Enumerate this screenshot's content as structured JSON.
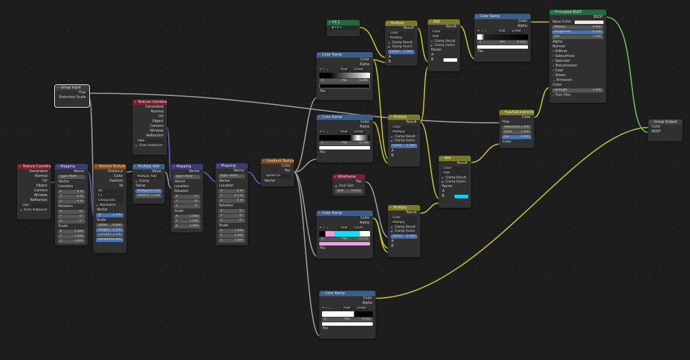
{
  "nodes": {
    "tex_coord_1": {
      "title": "Texture Coordinate",
      "outputs": [
        "Generated",
        "Normal",
        "UV",
        "Object",
        "Camera",
        "Window",
        "Reflection"
      ],
      "object_label": "Obje...",
      "from_instancer": "From Instancer"
    },
    "mapping_1": {
      "title": "Mapping",
      "out": "Vector",
      "type_label": "Type:",
      "type_value": "Point",
      "inputs": {
        "vector": "Vector",
        "location": "Location",
        "rotation": "Rotation",
        "scale": "Scale"
      },
      "location": [
        [
          "X",
          "0 m"
        ],
        [
          "Y",
          "0 m"
        ],
        [
          "Z",
          "0 m"
        ]
      ],
      "rotation": [
        [
          "X",
          "0°"
        ],
        [
          "Y",
          "0°"
        ],
        [
          "Z",
          "0°"
        ]
      ],
      "scale": [
        [
          "X",
          "1.000"
        ],
        [
          "Y",
          "1.000"
        ],
        [
          "Z",
          "1.000"
        ]
      ]
    },
    "voronoi": {
      "title": "Voronoi Texture",
      "outputs": [
        "Distance",
        "Color",
        "Position",
        "W"
      ],
      "dims": "4D",
      "feature": "F1",
      "metric": "Chebychev",
      "normalize": "Normalize",
      "vector": "Vector",
      "w_label": "W",
      "w_value": "1.200",
      "scale_label": "Scale",
      "detail_label": "Detail",
      "detail_value": "0.000",
      "rough_label": "Roughn...",
      "rough_value": "0.500",
      "lac_label": "Lacunari...",
      "lac_value": "2.000",
      "rand_label": "Randomn...",
      "rand_value": "1.000"
    },
    "mul_add": {
      "title": "Multiply Add",
      "out": "Value",
      "op": "Multiply Add",
      "clamp": "Clamp",
      "value": "Value",
      "mult_label": "Multiplier",
      "mult_value": "0.230",
      "add_label": "Addend",
      "add_value": "0.240"
    },
    "tex_coord_2": {
      "title": "Texture Coordinate",
      "outputs": [
        "Generated",
        "Normal",
        "UV",
        "Object",
        "Camera",
        "Window",
        "Reflection"
      ],
      "object_label": "Obje...",
      "from_instancer": "From Instancer"
    },
    "mapping_2": {
      "title": "Mapping",
      "out": "Vector",
      "type_label": "Type:",
      "type_value": "Point",
      "inputs": {
        "vector": "Vector",
        "location": "Location",
        "rotation": "Rotation",
        "scale": "Scale"
      },
      "location": [
        [
          "X",
          "0°"
        ],
        [
          "Y",
          "0°"
        ],
        [
          "Z",
          "0°"
        ]
      ],
      "scale": [
        [
          "X",
          "1.000"
        ],
        [
          "Y",
          "1.000"
        ],
        [
          "Z",
          "1.000"
        ]
      ]
    },
    "mapping_3": {
      "title": "Mapping",
      "out": "Vector",
      "type_label": "Type:",
      "type_value": "Point",
      "inputs": {
        "vector": "Vector",
        "location": "Location",
        "rotation": "Rotation",
        "scale": "Scale"
      },
      "location": [
        [
          "X",
          "0 m"
        ],
        [
          "Y",
          "0.3 m"
        ],
        [
          "Z",
          "0 m"
        ]
      ],
      "rotation": [
        [
          "X",
          "0°"
        ],
        [
          "Y",
          "0°"
        ],
        [
          "Z",
          "0°"
        ]
      ],
      "scale": [
        [
          "X",
          "1.000"
        ],
        [
          "Y",
          "1.000"
        ],
        [
          "Z",
          "1.000"
        ]
      ]
    },
    "gradient": {
      "title": "Gradient Texture",
      "outputs": [
        "Color",
        "Fac"
      ],
      "type": "Spherical",
      "vector": "Vector"
    },
    "group_input": {
      "title": "Group Input",
      "outputs": [
        "Hue",
        "Distortion Scale"
      ]
    },
    "fx": {
      "title": "FX 1",
      "value": "FX 1"
    },
    "ramp_1": {
      "title": "Color Ramp",
      "outputs": [
        "Color",
        "Alpha"
      ],
      "mode": "RGB",
      "interp": "Linear",
      "idx": "0",
      "pos_label": "Pos",
      "pos_value": "0.205",
      "fac": "Fac"
    },
    "ramp_2": {
      "title": "Color Ramp",
      "outputs": [
        "Color",
        "Alpha"
      ],
      "mode": "RGB",
      "interp": "Linear",
      "idx": "1",
      "pos_label": "Pos",
      "pos_value": "0.759",
      "fac": "Fac"
    },
    "ramp_3": {
      "title": "Color Ramp",
      "outputs": [
        "Color",
        "Alpha"
      ],
      "mode": "RGB",
      "interp": "Const...",
      "idx": "1",
      "pos_label": "Pos",
      "pos_value": "0.121",
      "fac": "Fac"
    },
    "ramp_4": {
      "title": "Color Ramp",
      "outputs": [
        "Color",
        "Alpha"
      ],
      "mode": "RGB",
      "interp": "Linear",
      "idx": "0",
      "pos_label": "Pos",
      "pos_value": "0.441",
      "fac": "Fac"
    },
    "ramp_5": {
      "title": "Color Ramp",
      "outputs": [
        "Color",
        "Alpha"
      ],
      "mode": "RGB",
      "interp": "Linear",
      "idx": "1",
      "pos_label": "Pos",
      "pos_value": "0.122",
      "fac": "Fac"
    },
    "wireframe": {
      "title": "Wireframe",
      "out": "Fac",
      "pixel_size": "Pixel Size",
      "size_label": "Size",
      "size_value": "0.050"
    },
    "multiply_1": {
      "title": "Multiply",
      "out": "Result",
      "blend": "Color",
      "op": "Multiply",
      "clamp_result": "Clamp Result",
      "clamp_factor": "Clamp Factor",
      "factor_label": "Factor",
      "factor_value": "1.000",
      "a": "A",
      "b": "B"
    },
    "multiply_2": {
      "title": "Multiply",
      "out": "Result",
      "blend": "Color",
      "op": "Multiply",
      "clamp_result": "Clamp Result",
      "clamp_factor": "Clamp Factor",
      "factor_label": "Factor",
      "factor_value": "1.000",
      "a": "A",
      "b": "B"
    },
    "multiply_3": {
      "title": "Multiply",
      "out": "Result",
      "blend": "Color",
      "op": "Multiply",
      "clamp_result": "Clamp Result",
      "clamp_factor": "Clamp Factor",
      "factor_label": "Factor",
      "factor_value": "1.000",
      "a": "A",
      "b": "B"
    },
    "add_1": {
      "title": "Add",
      "out": "Result",
      "blend": "Color",
      "op": "Add",
      "clamp_result": "Clamp Result",
      "clamp_factor": "Clamp Factor",
      "factor": "Factor",
      "a": "A",
      "b": "B"
    },
    "add_2": {
      "title": "Add",
      "out": "Result",
      "blend": "Color",
      "op": "Add",
      "clamp_result": "Clamp Result",
      "clamp_factor": "Clamp Factor",
      "factor": "Factor",
      "a": "A",
      "b": "B"
    },
    "hsv": {
      "title": "Hue/Saturation/Val...",
      "out": "Color",
      "hue": "Hue",
      "sat_label": "Saturation",
      "sat_value": "1.000",
      "val_label": "Value",
      "val_value": "1.000",
      "fac_label": "Fac",
      "fac_value": "1.000",
      "color": "Color"
    },
    "bsdf": {
      "title": "Principled BSDF",
      "out": "BSDF",
      "base_color": "Base Color",
      "metallic_label": "Metallic",
      "metallic_value": "0.000",
      "rough_label": "Roughness",
      "rough_value": "0.500",
      "ior_label": "IOR",
      "ior_value": "1.500",
      "alpha": "Alpha",
      "normal": "Normal",
      "panels": [
        "Diffuse",
        "Subsurface",
        "Specular",
        "Transmission",
        "Coat",
        "Sheen",
        "Emission"
      ],
      "color": "Color",
      "strength_label": "Strength",
      "strength_value": "1.000",
      "thin_film": "Thin Film"
    },
    "group_output": {
      "title": "Group Output",
      "inputs": [
        "Color",
        "BSDF"
      ]
    }
  },
  "colors": {
    "yellow_wire": "#c7c729",
    "gray_wire": "#a1a1a1",
    "green_wire": "#63c763",
    "purple_wire": "#6363c7",
    "cyan_swatch": "#00d5ff",
    "pink_ramp": "#ff9ae6"
  }
}
